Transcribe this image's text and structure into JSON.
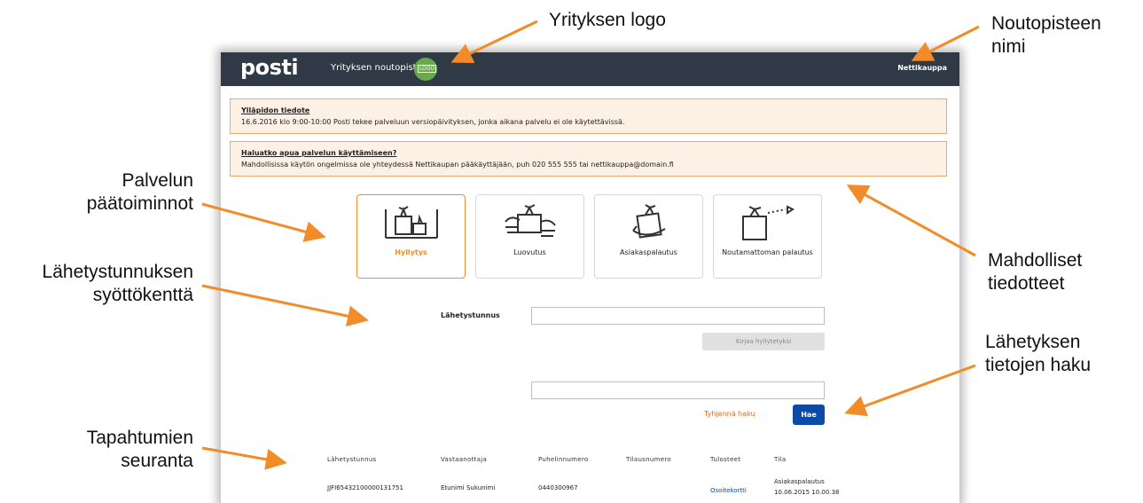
{
  "annotations": {
    "company_logo": "Yrityksen logo",
    "pickup_name_l1": "Noutopisteen",
    "pickup_name_l2": "nimi",
    "main_functions_l1": "Palvelun",
    "main_functions_l2": "päätoiminnot",
    "tracking_input_l1": "Lähetystunnuksen",
    "tracking_input_l2": "syöttökenttä",
    "notices_l1": "Mahdolliset",
    "notices_l2": "tiedotteet",
    "shipment_search_l1": "Lähetyksen",
    "shipment_search_l2": "tietojen haku",
    "event_tracking_l1": "Tapahtumien",
    "event_tracking_l2": "seuranta"
  },
  "header": {
    "brand": "posti",
    "site_name": "Yrityksen noutopiste",
    "logo_text": "LOGO",
    "pickup_point": "Nettikauppa"
  },
  "notices": [
    {
      "title": "Ylläpidon tiedote",
      "text": "16.6.2016 klo 9:00-10:00 Posti tekee palveluun versiopäivityksen, jonka aikana palvelu ei ole käytettävissä."
    },
    {
      "title": "Haluatko apua palvelun käyttämiseen?",
      "text": "Mahdollisissa käytön ongelmissa ole yhteydessä Nettikaupan pääkäyttäjään, puh 020 555 555 tai nettikauppa@domain.fi"
    }
  ],
  "actions": [
    {
      "label": "Hyllytys",
      "icon": "shelf-icon"
    },
    {
      "label": "Luovutus",
      "icon": "handover-icon"
    },
    {
      "label": "Asiakaspalautus",
      "icon": "return-icon"
    },
    {
      "label": "Noutamattoman palautus",
      "icon": "unclaimed-return-icon"
    }
  ],
  "form": {
    "tracking_label": "Lähetystunnus",
    "tracking_value": "",
    "shelve_button": "Kirjaa hyllytetyksi",
    "search_value": "",
    "clear_label": "Tyhjennä haku",
    "search_button": "Hae"
  },
  "table": {
    "columns": [
      "Lähetystunnus",
      "Vastaanottaja",
      "Puhelinnumero",
      "Tilausnumero",
      "Tulosteet",
      "Tila"
    ],
    "rows": [
      {
        "tracking": "JJFI65432100000131751",
        "recipient": "Etunimi Sukunimi",
        "phone": "0440300967",
        "order": "",
        "prints": "Osoitekortti",
        "status": "Asiakaspalautus",
        "status_time": "10.06.2015 10.00.38"
      }
    ]
  },
  "colors": {
    "accent": "#f28c28",
    "header": "#2f3a46",
    "primary": "#0d4aa8",
    "notice_bg": "#fdf1e6"
  }
}
